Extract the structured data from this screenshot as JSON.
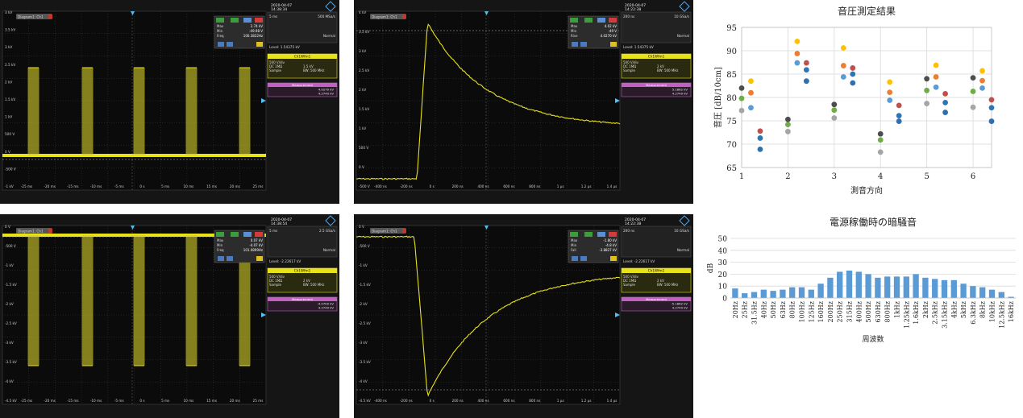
{
  "scopes": [
    {
      "id": "scope1",
      "date": "2020-04-07",
      "time": "14:38:34",
      "tab": "Diagram1: Ch1",
      "hscale": "5 ms",
      "srate": "500 MSa/s",
      "trig_mode": "Normal",
      "trig_level": "Level: 1.54375 kV",
      "measure": {
        "m1": "Max",
        "v1": "2.74 kV",
        "m2": "Min",
        "v2": "-49.98 V",
        "m3": "Freq",
        "v3": "100.3822Hz"
      },
      "ch_title": "Ch1Wfm1",
      "ch_lines": [
        "500 V/div",
        "DC 1MΩ",
        "Sample"
      ],
      "ch_lines_r": [
        "1.5 kV",
        "BW: 500 MHz"
      ],
      "pink_title": "Measurement",
      "pink_vals": [
        "4.0270 kV",
        "4.2740 kV"
      ],
      "yticks": [
        "3 kV",
        "3.5 kV",
        "3 kV",
        "2.5 kV",
        "2 kV",
        "1.5 kV",
        "1 kV",
        "500 V",
        "0 V",
        "-500 V",
        "-1 kV"
      ],
      "xticks": [
        "-25 ms",
        "-20 ms",
        "-15 ms",
        "-10 ms",
        "-5 ms",
        "0 s",
        "5 ms",
        "10 ms",
        "15 ms",
        "20 ms",
        "25 ms"
      ]
    },
    {
      "id": "scope2",
      "date": "2020-04-07",
      "time": "14:22:38",
      "tab": "Diagram1: Ch1",
      "hscale": "200 ns",
      "srate": "10 GSa/s",
      "trig_mode": "Normal",
      "trig_level": "Level: 1.54375 kV",
      "measure": {
        "m1": "Max",
        "v1": "4.02 kV",
        "m2": "Min",
        "v2": "-49 V",
        "m3": "Rise",
        "v3": "4.0270 kV"
      },
      "ch_title": "Ch1Wfm1",
      "ch_lines": [
        "500 V/div",
        "DC 1MΩ",
        "Sample"
      ],
      "ch_lines_r": [
        "2 kV",
        "BW: 500 MHz"
      ],
      "pink_title": "Measurement",
      "pink_vals": [
        "5.1862 kV",
        "4.2740 kV"
      ],
      "yticks": [
        "4 kV",
        "3.5 kV",
        "3 kV",
        "2.5 kV",
        "2 kV",
        "1.5 kV",
        "1 kV",
        "500 V",
        "0 V",
        "-500 V"
      ],
      "xticks": [
        "-400 ns",
        "-200 ns",
        "0 s",
        "200 ns",
        "400 ns",
        "600 ns",
        "800 ns",
        "1 µs",
        "1.2 µs",
        "1.4 µs"
      ]
    },
    {
      "id": "scope3",
      "date": "2020-04-07",
      "time": "14:38:54",
      "tab": "Diagram1: Ch1",
      "hscale": "5 ms",
      "srate": "2.5 GSa/s",
      "trig_mode": "Normal",
      "trig_level": "Level: -2.22617 kV",
      "measure": {
        "m1": "Max",
        "v1": "0.07 kV",
        "m2": "Min",
        "v2": "-4.07 kV",
        "m3": "Freq",
        "v3": "101.0899Hz"
      },
      "ch_title": "Ch1Wfm1",
      "ch_lines": [
        "500 V/div",
        "DC 1MΩ",
        "Sample"
      ],
      "ch_lines_r": [
        "2 kV",
        "BW: 500 MHz"
      ],
      "pink_title": "Measurement",
      "pink_vals": [
        "-4.0700 kV",
        "4.2740 kV"
      ],
      "yticks": [
        "0 V",
        "-500 V",
        "-1 kV",
        "-1.5 kV",
        "-2 kV",
        "-2.5 kV",
        "-3 kV",
        "-3.5 kV",
        "-4 kV",
        "-4.5 kV"
      ],
      "xticks": [
        "-25 ms",
        "-20 ms",
        "-15 ms",
        "-10 ms",
        "-5 ms",
        "0 s",
        "5 ms",
        "10 ms",
        "15 ms",
        "20 ms",
        "25 ms"
      ]
    },
    {
      "id": "scope4",
      "date": "2020-04-07",
      "time": "14:22:38",
      "tab": "Diagram1: Ch1",
      "hscale": "200 ns",
      "srate": "10 GSa/s",
      "trig_mode": "Normal",
      "trig_level": "Level: -2.22617 kV",
      "measure": {
        "m1": "Max",
        "v1": "-1.80 kV",
        "m2": "Min",
        "v2": "-4.8 kV",
        "m3": "Fall",
        "v3": "-3.8827 kV"
      },
      "ch_title": "Ch1Wfm1",
      "ch_lines": [
        "500 V/div",
        "DC 1MΩ",
        "Sample"
      ],
      "ch_lines_r": [
        "2 kV",
        "BW: 500 MHz"
      ],
      "pink_title": "Measurement",
      "pink_vals": [
        "-5.1862 kV",
        "4.2740 kV"
      ],
      "yticks": [
        "0 V",
        "-500 V",
        "-1 kV",
        "-1.5 kV",
        "-2 kV",
        "-2.5 kV",
        "-3 kV",
        "-3.5 kV",
        "-4 kV",
        "-4.5 kV"
      ],
      "xticks": [
        "-400 ns",
        "-200 ns",
        "0 s",
        "200 ns",
        "400 ns",
        "600 ns",
        "800 ns",
        "1 µs",
        "1.2 µs",
        "1.4 µs"
      ]
    }
  ],
  "chart_data": [
    {
      "type": "scatter",
      "title": "音圧測定結果",
      "xlabel": "測音方向",
      "ylabel": "音圧 [dB/10cm]",
      "xlim": [
        1,
        6.4
      ],
      "ylim": [
        65,
        95
      ],
      "xticks": [
        1,
        2,
        3,
        4,
        5,
        6
      ],
      "yticks": [
        65,
        70,
        75,
        80,
        85,
        90,
        95
      ],
      "grid": true,
      "series": [
        {
          "color": "#4d4d4d",
          "points": [
            [
              1.0,
              82.0
            ],
            [
              2.0,
              75.3
            ],
            [
              3.0,
              78.5
            ],
            [
              4.0,
              72.2
            ],
            [
              5.0,
              84.0
            ],
            [
              6.0,
              84.2
            ]
          ]
        },
        {
          "color": "#70ad47",
          "points": [
            [
              1.0,
              79.8
            ],
            [
              2.0,
              74.2
            ],
            [
              3.0,
              77.3
            ],
            [
              4.0,
              70.9
            ],
            [
              5.0,
              81.5
            ],
            [
              6.0,
              81.3
            ]
          ]
        },
        {
          "color": "#a5a5a5",
          "points": [
            [
              1.0,
              77.2
            ],
            [
              2.0,
              72.7
            ],
            [
              3.0,
              75.6
            ],
            [
              4.0,
              68.3
            ],
            [
              5.0,
              78.7
            ],
            [
              6.0,
              77.9
            ]
          ]
        },
        {
          "color": "#5b9bd5",
          "points": [
            [
              1.2,
              77.8
            ],
            [
              2.2,
              87.4
            ],
            [
              3.2,
              84.4
            ],
            [
              4.2,
              79.4
            ],
            [
              5.2,
              82.2
            ],
            [
              6.2,
              82.0
            ]
          ]
        },
        {
          "color": "#ed7d31",
          "points": [
            [
              1.2,
              81.0
            ],
            [
              2.2,
              89.4
            ],
            [
              3.2,
              86.8
            ],
            [
              4.2,
              81.1
            ],
            [
              5.2,
              84.4
            ],
            [
              6.2,
              83.6
            ]
          ]
        },
        {
          "color": "#ffc000",
          "points": [
            [
              1.2,
              83.5
            ],
            [
              2.2,
              92.0
            ],
            [
              3.2,
              90.6
            ],
            [
              4.2,
              83.3
            ],
            [
              5.2,
              86.9
            ],
            [
              6.2,
              85.7
            ]
          ]
        },
        {
          "color": "#c0504d",
          "points": [
            [
              1.4,
              72.8
            ],
            [
              2.4,
              87.4
            ],
            [
              3.4,
              86.3
            ],
            [
              4.4,
              78.3
            ],
            [
              5.4,
              80.8
            ],
            [
              6.4,
              79.5
            ]
          ]
        },
        {
          "color": "#2e75b6",
          "points": [
            [
              1.4,
              71.3
            ],
            [
              2.4,
              85.9
            ],
            [
              3.4,
              85.0
            ],
            [
              4.4,
              76.1
            ],
            [
              5.4,
              78.9
            ],
            [
              6.4,
              77.8
            ]
          ]
        },
        {
          "color": "#2f6fb0",
          "points": [
            [
              1.4,
              68.9
            ],
            [
              2.4,
              83.5
            ],
            [
              3.4,
              83.1
            ],
            [
              4.4,
              74.9
            ],
            [
              5.4,
              76.8
            ],
            [
              6.4,
              74.9
            ]
          ]
        }
      ]
    },
    {
      "type": "bar",
      "title": "電源稼働時の暗騒音",
      "xlabel": "周波数",
      "ylabel": "dB",
      "ylim": [
        0,
        50
      ],
      "yticks": [
        0,
        10,
        20,
        30,
        40,
        50
      ],
      "grid": true,
      "color": "#5b9bd5",
      "categories": [
        "20Hz",
        "25Hz",
        "31.5Hz",
        "40Hz",
        "50Hz",
        "63Hz",
        "80Hz",
        "100Hz",
        "125Hz",
        "160Hz",
        "200Hz",
        "250Hz",
        "315Hz",
        "400Hz",
        "500Hz",
        "630Hz",
        "800Hz",
        "1kHz",
        "1.25kHz",
        "1.6kHz",
        "2kHz",
        "2.5kHz",
        "3.15kHz",
        "4kHz",
        "5kHz",
        "6.3kHz",
        "8kHz",
        "10kHz",
        "12.5kHz",
        "16kHz"
      ],
      "values": [
        8,
        4,
        5,
        7,
        6,
        7,
        9,
        9,
        7,
        12,
        17,
        22,
        23,
        22,
        20,
        17,
        18,
        18,
        18,
        20,
        17,
        16,
        15,
        15,
        12,
        10,
        9,
        7,
        5,
        1
      ]
    }
  ]
}
